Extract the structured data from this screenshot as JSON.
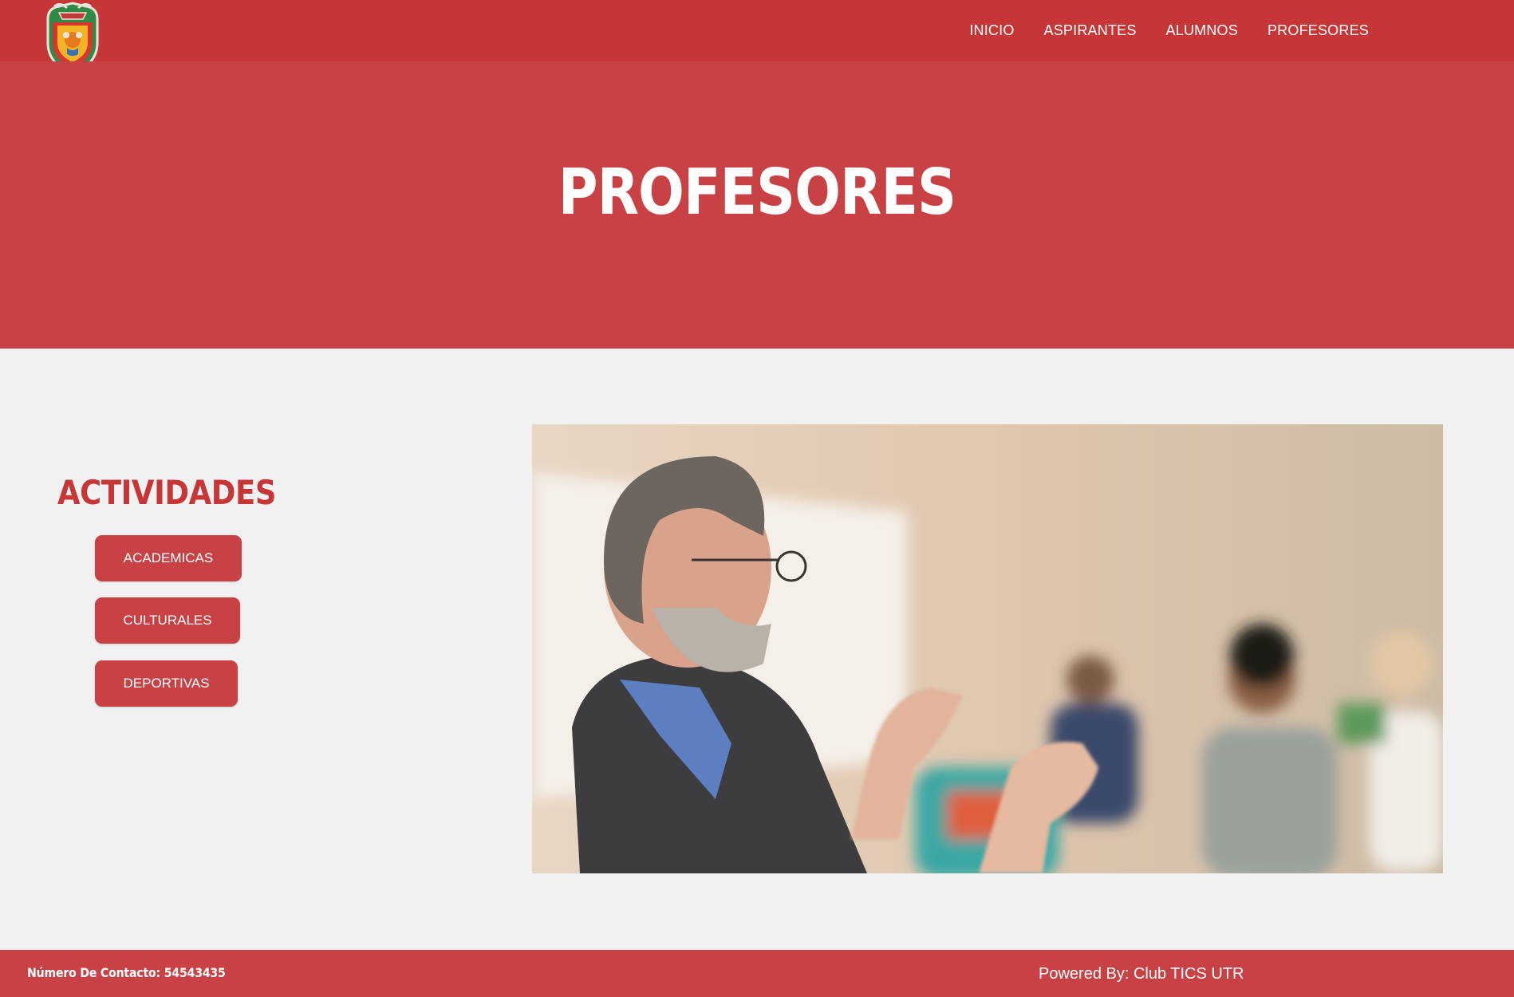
{
  "nav": {
    "items": [
      {
        "label": "INICIO"
      },
      {
        "label": "ASPIRANTES"
      },
      {
        "label": "ALUMNOS"
      },
      {
        "label": "PROFESORES"
      }
    ]
  },
  "logo": {
    "icon": "university-crest-icon"
  },
  "hero": {
    "title": "PROFESORES"
  },
  "activities": {
    "title": "ACTIVIDADES",
    "buttons": [
      {
        "label": "ACADEMICAS"
      },
      {
        "label": "CULTURALES"
      },
      {
        "label": "DEPORTIVAS"
      }
    ]
  },
  "photo": {
    "subject": "professor-teaching-class"
  },
  "footer": {
    "contact": "Número De Contacto: 54543435",
    "powered": "Powered By: Club TICS UTR"
  },
  "colors": {
    "header": "#c73637",
    "hero": "#c84144",
    "background": "#f0f1f0",
    "accent_text": "#c73637"
  }
}
